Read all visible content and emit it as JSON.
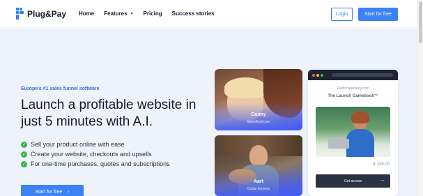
{
  "nav": {
    "logo_text": "Plug&Pay",
    "links": [
      "Home",
      "Features",
      "Pricing",
      "Success stories"
    ],
    "login_label": "Login",
    "start_label": "Start for free"
  },
  "hero": {
    "eyebrow": "Europe's #1 sales funnel software",
    "headline": "Launch a profitable website in just 5 minutes with A.I.",
    "features": [
      "Sell your product online with ease",
      "Create your website, checkouts and upsells",
      "For one-time purchases, quotes and subscriptions"
    ],
    "cta_label": "Start for free",
    "cta_arrow": "›"
  },
  "cards": [
    {
      "name": "Conny",
      "sub": "tritmethod.com"
    },
    {
      "name": "Aart",
      "sub": "Guitar lessons"
    }
  ],
  "mockup": {
    "site": "Feelforwardsary.com",
    "title": "The Launch Gamebook™",
    "price": "€ 239,00",
    "button_label": "Get access",
    "button_arrow": "→"
  },
  "colors": {
    "accent": "#3b82f6",
    "check": "#3bb54a",
    "hero_bg": "#eef3fb"
  }
}
